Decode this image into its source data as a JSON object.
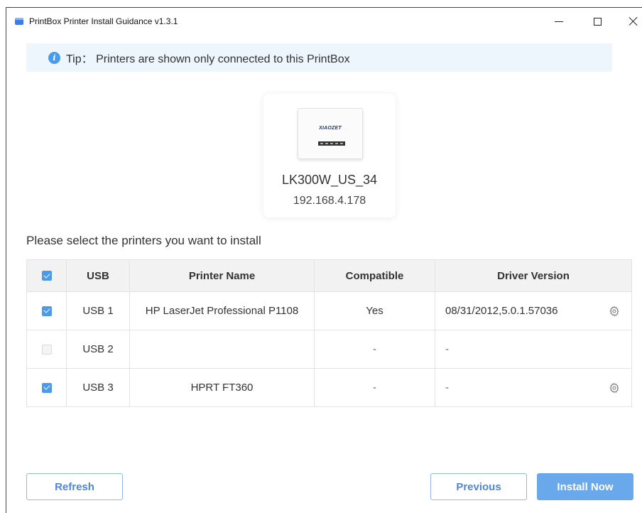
{
  "window": {
    "title": "PrintBox Printer Install Guidance v1.3.1",
    "controls": {
      "minimize": "minimize",
      "maximize": "maximize",
      "close": "close"
    }
  },
  "tip": {
    "text": "Tip： Printers are shown only connected to this PrintBox",
    "icon": "info-icon"
  },
  "device": {
    "logo": "XIAOZET",
    "name": "LK300W_US_34",
    "ip": "192.168.4.178"
  },
  "section_label": "Please select the printers you want to install",
  "table": {
    "select_all_checked": true,
    "headers": {
      "usb": "USB",
      "printer_name": "Printer Name",
      "compatible": "Compatible",
      "driver_version": "Driver Version"
    },
    "rows": [
      {
        "checked": true,
        "usb": "USB 1",
        "printer_name": "HP LaserJet Professional P1108",
        "compatible": "Yes",
        "driver_version": "08/31/2012,5.0.1.57036",
        "has_settings": true
      },
      {
        "checked": false,
        "usb": "USB 2",
        "printer_name": "",
        "compatible": "-",
        "driver_version": "-",
        "has_settings": false
      },
      {
        "checked": true,
        "usb": "USB 3",
        "printer_name": "HPRT FT360",
        "compatible": "-",
        "driver_version": "-",
        "has_settings": true
      }
    ]
  },
  "buttons": {
    "refresh": "Refresh",
    "previous": "Previous",
    "install": "Install Now"
  },
  "colors": {
    "accent": "#4b9bea",
    "primary_button": "#6aa8ec",
    "outline_button_text": "#4f86d8",
    "tip_background": "#eef6fd"
  }
}
